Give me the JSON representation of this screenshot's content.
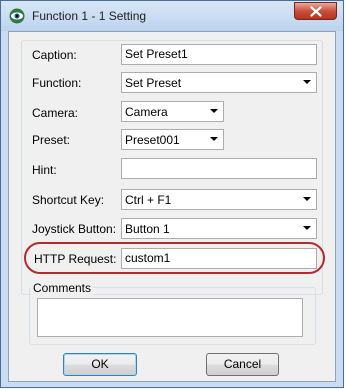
{
  "window": {
    "title": "Function 1 - 1 Setting"
  },
  "icons": {
    "app": "eye-icon",
    "close": "close-x-icon",
    "dropdown": "chevron-down-icon"
  },
  "colors": {
    "highlight_ring": "#b12c2c",
    "close_button": "#c9503c"
  },
  "form": {
    "caption": {
      "label": "Caption:",
      "value": "Set Preset1"
    },
    "function": {
      "label": "Function:",
      "value": "Set Preset"
    },
    "camera": {
      "label": "Camera:",
      "value": "Camera"
    },
    "preset": {
      "label": "Preset:",
      "value": "Preset001"
    },
    "hint": {
      "label": "Hint:",
      "value": ""
    },
    "shortcut_key": {
      "label": "Shortcut Key:",
      "value": "Ctrl + F1"
    },
    "joystick_button": {
      "label": "Joystick Button:",
      "value": "Button 1"
    },
    "http_request": {
      "label": "HTTP Request:",
      "value": "custom1"
    }
  },
  "comments": {
    "legend": "Comments",
    "value": ""
  },
  "buttons": {
    "ok": "OK",
    "cancel": "Cancel"
  }
}
